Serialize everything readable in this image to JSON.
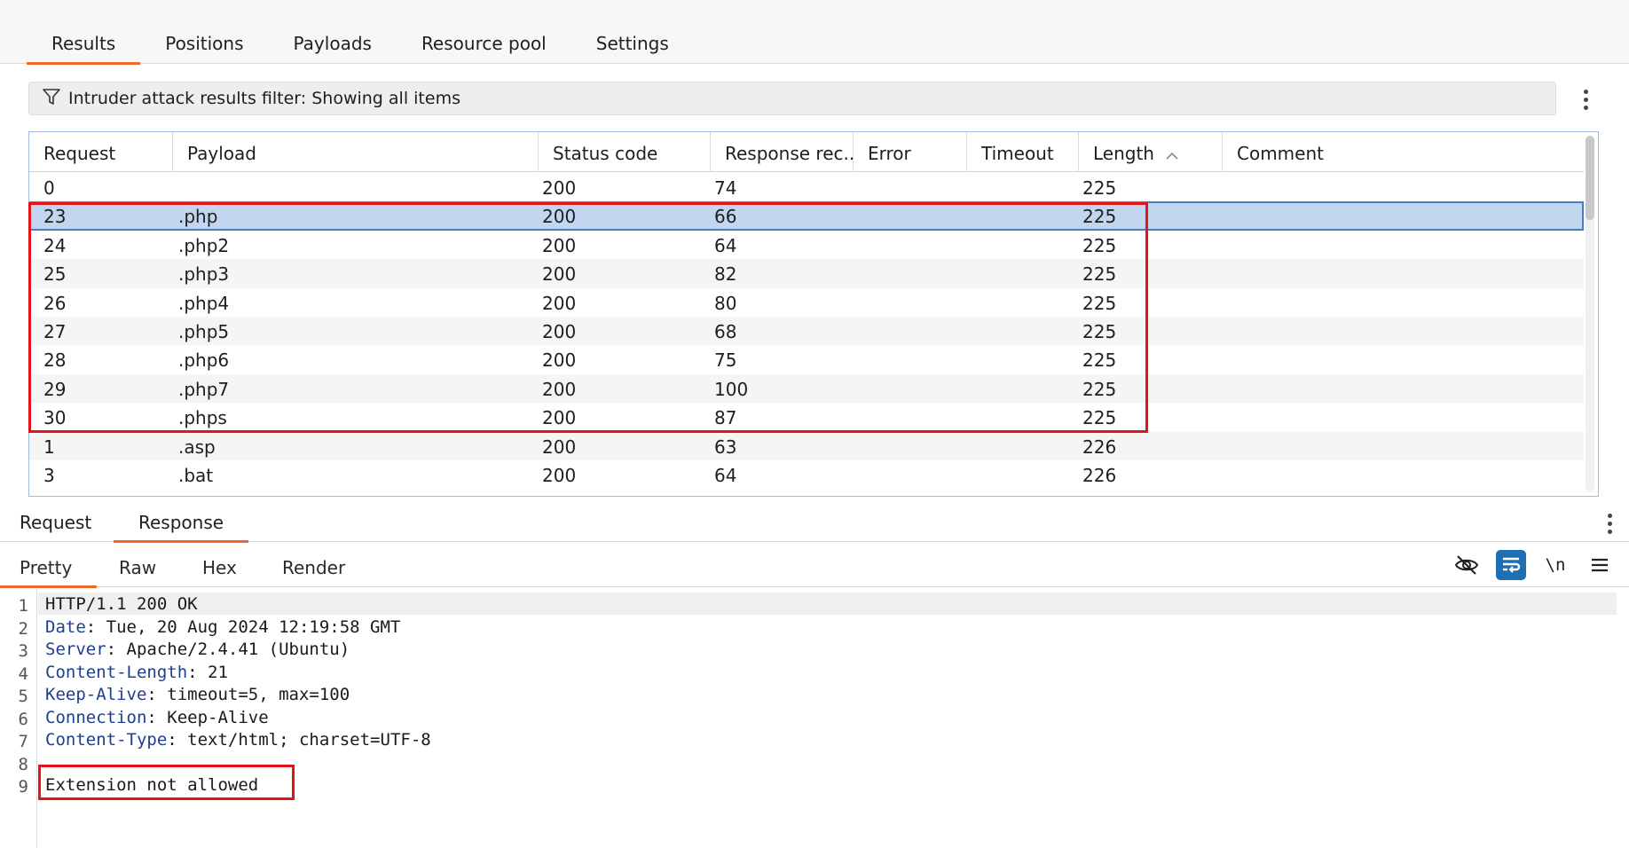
{
  "top_tabs": [
    "Results",
    "Positions",
    "Payloads",
    "Resource pool",
    "Settings"
  ],
  "filter": {
    "icon": "funnel-icon",
    "text": "Intruder attack results filter: Showing all items"
  },
  "table": {
    "headers": [
      "Request",
      "Payload",
      "Status code",
      "Response rec...",
      "Error",
      "Timeout",
      "Length",
      "Comment"
    ],
    "sort": {
      "column": "Length",
      "direction": "ascending",
      "icon": "chevron-up-icon"
    },
    "rows": [
      {
        "request": "0",
        "payload": "",
        "status": "200",
        "response": "74",
        "error": "",
        "timeout": "",
        "length": "225",
        "comment": ""
      },
      {
        "request": "23",
        "payload": ".php",
        "status": "200",
        "response": "66",
        "error": "",
        "timeout": "",
        "length": "225",
        "comment": "",
        "selected": true
      },
      {
        "request": "24",
        "payload": ".php2",
        "status": "200",
        "response": "64",
        "error": "",
        "timeout": "",
        "length": "225",
        "comment": ""
      },
      {
        "request": "25",
        "payload": ".php3",
        "status": "200",
        "response": "82",
        "error": "",
        "timeout": "",
        "length": "225",
        "comment": ""
      },
      {
        "request": "26",
        "payload": ".php4",
        "status": "200",
        "response": "80",
        "error": "",
        "timeout": "",
        "length": "225",
        "comment": ""
      },
      {
        "request": "27",
        "payload": ".php5",
        "status": "200",
        "response": "68",
        "error": "",
        "timeout": "",
        "length": "225",
        "comment": ""
      },
      {
        "request": "28",
        "payload": ".php6",
        "status": "200",
        "response": "75",
        "error": "",
        "timeout": "",
        "length": "225",
        "comment": ""
      },
      {
        "request": "29",
        "payload": ".php7",
        "status": "200",
        "response": "100",
        "error": "",
        "timeout": "",
        "length": "225",
        "comment": ""
      },
      {
        "request": "30",
        "payload": ".phps",
        "status": "200",
        "response": "87",
        "error": "",
        "timeout": "",
        "length": "225",
        "comment": ""
      },
      {
        "request": "1",
        "payload": ".asp",
        "status": "200",
        "response": "63",
        "error": "",
        "timeout": "",
        "length": "226",
        "comment": ""
      },
      {
        "request": "3",
        "payload": ".bat",
        "status": "200",
        "response": "64",
        "error": "",
        "timeout": "",
        "length": "226",
        "comment": ""
      }
    ]
  },
  "message_tabs": [
    "Request",
    "Response"
  ],
  "view_tabs": [
    "Pretty",
    "Raw",
    "Hex",
    "Render"
  ],
  "toolbar": {
    "hide_icon": "eye-slash-icon",
    "wrap_icon": "word-wrap-icon",
    "newline_label": "\\n",
    "menu_icon": "hamburger-menu-icon"
  },
  "response_lines": [
    {
      "num": "1",
      "key": "",
      "value": "HTTP/1.1 200 OK"
    },
    {
      "num": "2",
      "key": "Date",
      "value": ": Tue, 20 Aug 2024 12:19:58 GMT"
    },
    {
      "num": "3",
      "key": "Server",
      "value": ": Apache/2.4.41 (Ubuntu)"
    },
    {
      "num": "4",
      "key": "Content-Length",
      "value": ": 21"
    },
    {
      "num": "5",
      "key": "Keep-Alive",
      "value": ": timeout=5, max=100"
    },
    {
      "num": "6",
      "key": "Connection",
      "value": ": Keep-Alive"
    },
    {
      "num": "7",
      "key": "Content-Type",
      "value": ": text/html; charset=UTF-8"
    },
    {
      "num": "8",
      "key": "",
      "value": ""
    },
    {
      "num": "9",
      "key": "",
      "value": "Extension not allowed"
    }
  ],
  "colors": {
    "accent": "#f0682d",
    "selected_row": "#c3d6ef",
    "highlight_box": "#e3141a",
    "header_key": "#1d3f8f",
    "tool_active": "#1f6fb5"
  }
}
